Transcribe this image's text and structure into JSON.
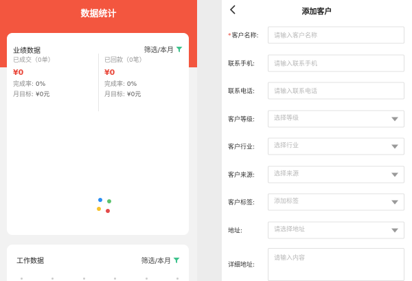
{
  "stats_page": {
    "title": "数据统计",
    "performance": {
      "title": "业绩数据",
      "filter": "筛选/本月",
      "deals": {
        "label": "已成交（0单）",
        "amount": "¥0",
        "rate_label": "完成率:",
        "rate_value": "0%",
        "target_label": "月目标:",
        "target_value": "¥0元"
      },
      "payments": {
        "label": "已回款（0笔）",
        "amount": "¥0",
        "rate_label": "完成率:",
        "rate_value": "0%",
        "target_label": "月目标:",
        "target_value": "¥0元"
      }
    },
    "work": {
      "title": "工作数据",
      "filter": "筛选/本月"
    },
    "colors": {
      "brand": "#f3563f",
      "amount": "#e9473a",
      "filter_icon": "#3cc28c"
    }
  },
  "add_customer": {
    "title": "添加客户",
    "back_icon": "chevron-left-icon",
    "required_mark": "*",
    "fields": [
      {
        "label": "客户名称:",
        "placeholder": "请输入客户名称",
        "type": "input",
        "required": true
      },
      {
        "label": "联系手机:",
        "placeholder": "请输入联系手机",
        "type": "input"
      },
      {
        "label": "联系电话:",
        "placeholder": "请输入联系电话",
        "type": "input"
      },
      {
        "label": "客户等级:",
        "placeholder": "选择等级",
        "type": "select"
      },
      {
        "label": "客户行业:",
        "placeholder": "选择行业",
        "type": "select"
      },
      {
        "label": "客户来源:",
        "placeholder": "选择来源",
        "type": "select"
      },
      {
        "label": "客户标签:",
        "placeholder": "添加标签",
        "type": "select"
      },
      {
        "label": "地址:",
        "placeholder": "请选择地址",
        "type": "select"
      }
    ],
    "detail_address": {
      "label": "详细地址:",
      "placeholder": "请输入内容"
    }
  }
}
